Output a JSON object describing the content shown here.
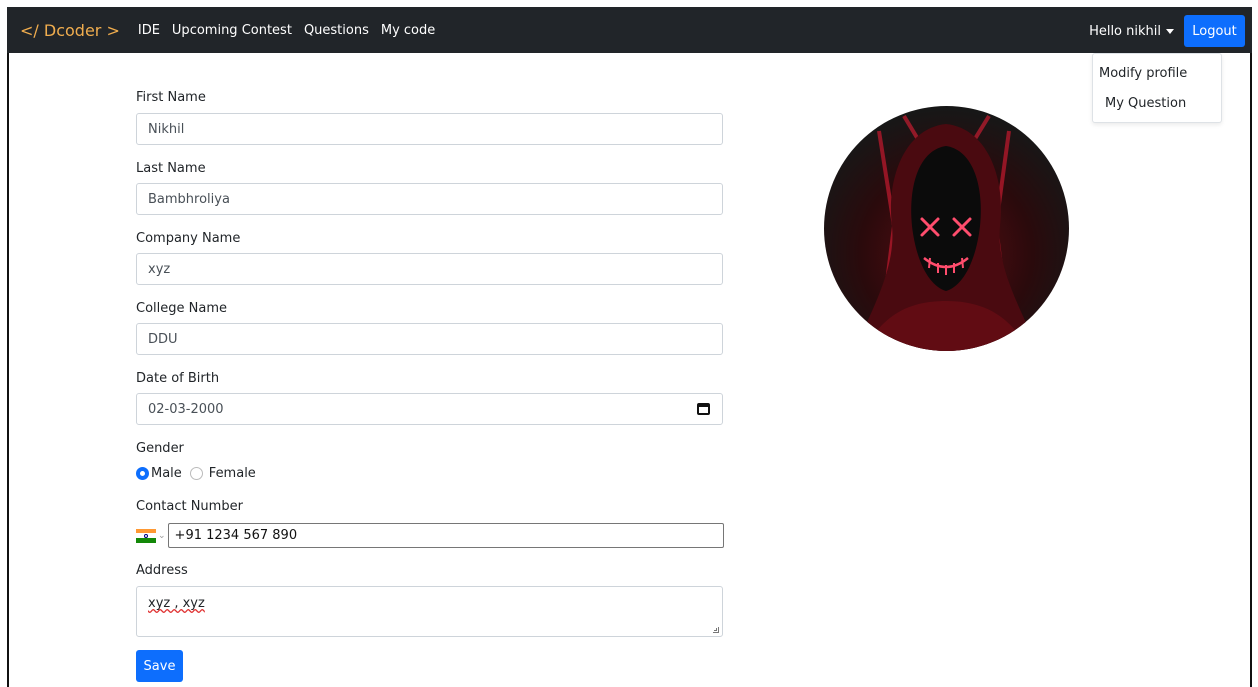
{
  "navbar": {
    "brand": "</ Dcoder >",
    "links": [
      "IDE",
      "Upcoming Contest",
      "Questions",
      "My code"
    ],
    "greeting": "Hello nikhil",
    "logout_label": "Logout"
  },
  "dropdown": {
    "items": [
      "Modify profile",
      "My Question"
    ]
  },
  "form": {
    "first_name": {
      "label": "First Name",
      "value": "Nikhil"
    },
    "last_name": {
      "label": "Last Name",
      "value": "Bambhroliya"
    },
    "company_name": {
      "label": "Company Name",
      "value": "xyz"
    },
    "college_name": {
      "label": "College Name",
      "value": "DDU"
    },
    "dob": {
      "label": "Date of Birth",
      "value": "02-03-2000"
    },
    "gender": {
      "label": "Gender",
      "options": [
        "Male",
        "Female"
      ],
      "selected": "Male"
    },
    "contact": {
      "label": "Contact Number",
      "value": "+91 1234 567 890",
      "country": "India"
    },
    "address": {
      "label": "Address",
      "value": "xyz , xyz"
    },
    "save_label": "Save"
  },
  "colors": {
    "navbar_bg": "#212529",
    "brand": "#f0ad4e",
    "primary": "#0d6efd"
  },
  "icons": [
    "calendar-icon",
    "caret-down-icon",
    "india-flag-icon",
    "resize-grip-icon"
  ]
}
